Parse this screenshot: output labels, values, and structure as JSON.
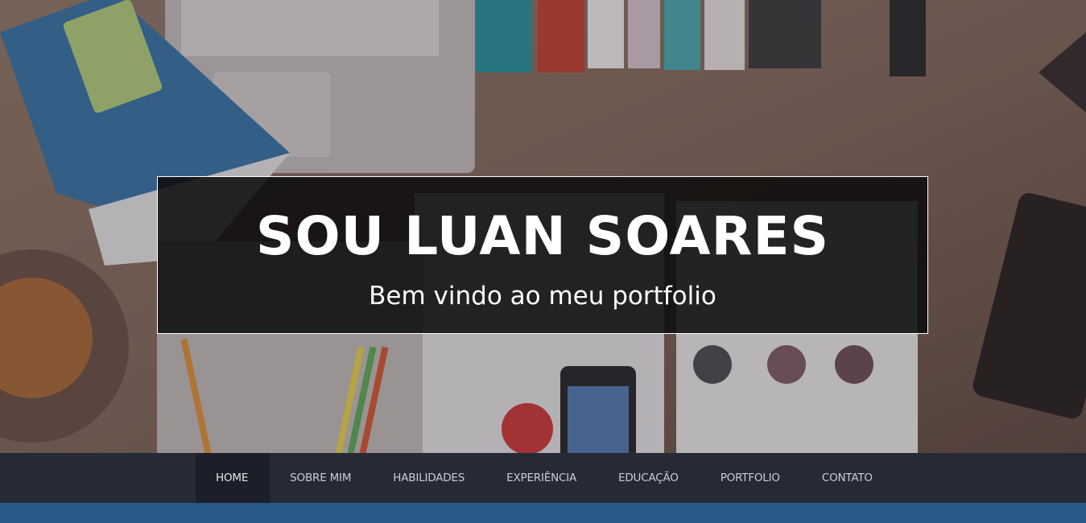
{
  "hero": {
    "title": "SOU LUAN SOARES",
    "subtitle": "Bem vindo ao meu portfolio"
  },
  "nav": {
    "items": [
      {
        "label": "HOME",
        "active": true
      },
      {
        "label": "SOBRE MIM",
        "active": false
      },
      {
        "label": "HABILIDADES",
        "active": false
      },
      {
        "label": "EXPERIÊNCIA",
        "active": false
      },
      {
        "label": "EDUCAÇÃO",
        "active": false
      },
      {
        "label": "PORTFOLIO",
        "active": false
      },
      {
        "label": "CONTATO",
        "active": false
      }
    ]
  },
  "colors": {
    "navbar": "#262a37",
    "nav_active": "#1c1f29",
    "strip": "#2a5887"
  }
}
